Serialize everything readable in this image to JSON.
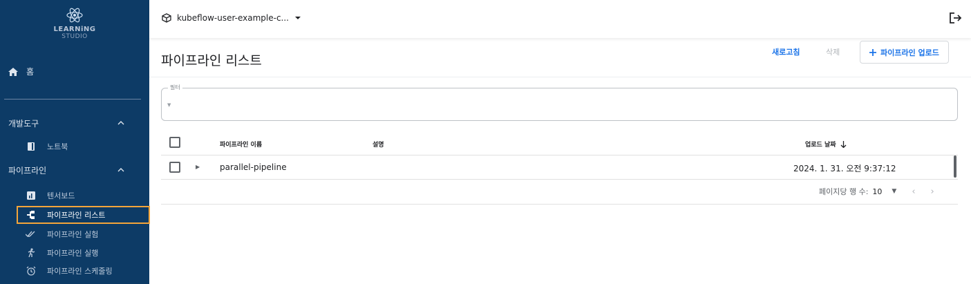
{
  "sidebar": {
    "logo_line1": "LEARNiNG",
    "logo_line2": "STUDIO",
    "home_label": "홈",
    "sections": [
      {
        "label": "개발도구",
        "items": [
          {
            "label": "노트북",
            "icon": "notebook-icon"
          }
        ]
      },
      {
        "label": "파이프라인",
        "items": [
          {
            "label": "텐서보드",
            "icon": "chart-icon"
          },
          {
            "label": "파이프라인 리스트",
            "icon": "pipeline-icon",
            "active": true
          },
          {
            "label": "파이프라인 실험",
            "icon": "done-all-icon"
          },
          {
            "label": "파이프라인 실행",
            "icon": "run-icon"
          },
          {
            "label": "파이프라인 스케줄링",
            "icon": "alarm-icon"
          }
        ]
      }
    ]
  },
  "topbar": {
    "namespace": "kubeflow-user-example-c...",
    "icons": [
      "cube-icon",
      "dropdown-caret-icon",
      "logout-icon"
    ]
  },
  "main": {
    "title": "파이프라인 리스트",
    "actions": {
      "refresh": "새로고침",
      "delete": "삭제",
      "upload": "파이프라인 업로드"
    },
    "filter_label": "필터",
    "table": {
      "columns": [
        "파이프라인 이름",
        "설명",
        "업로드 날짜"
      ],
      "rows": [
        {
          "name": "parallel-pipeline",
          "description": "",
          "uploaded": "2024. 1. 31. 오전 9:37:12"
        }
      ]
    },
    "pagination": {
      "rows_per_page_label": "페이지당 행 수:",
      "rows_per_page_value": "10"
    }
  },
  "colors": {
    "sidebar_bg": "#0d3b66",
    "accent": "#1a73e8",
    "active_border": "#f4a53a"
  }
}
